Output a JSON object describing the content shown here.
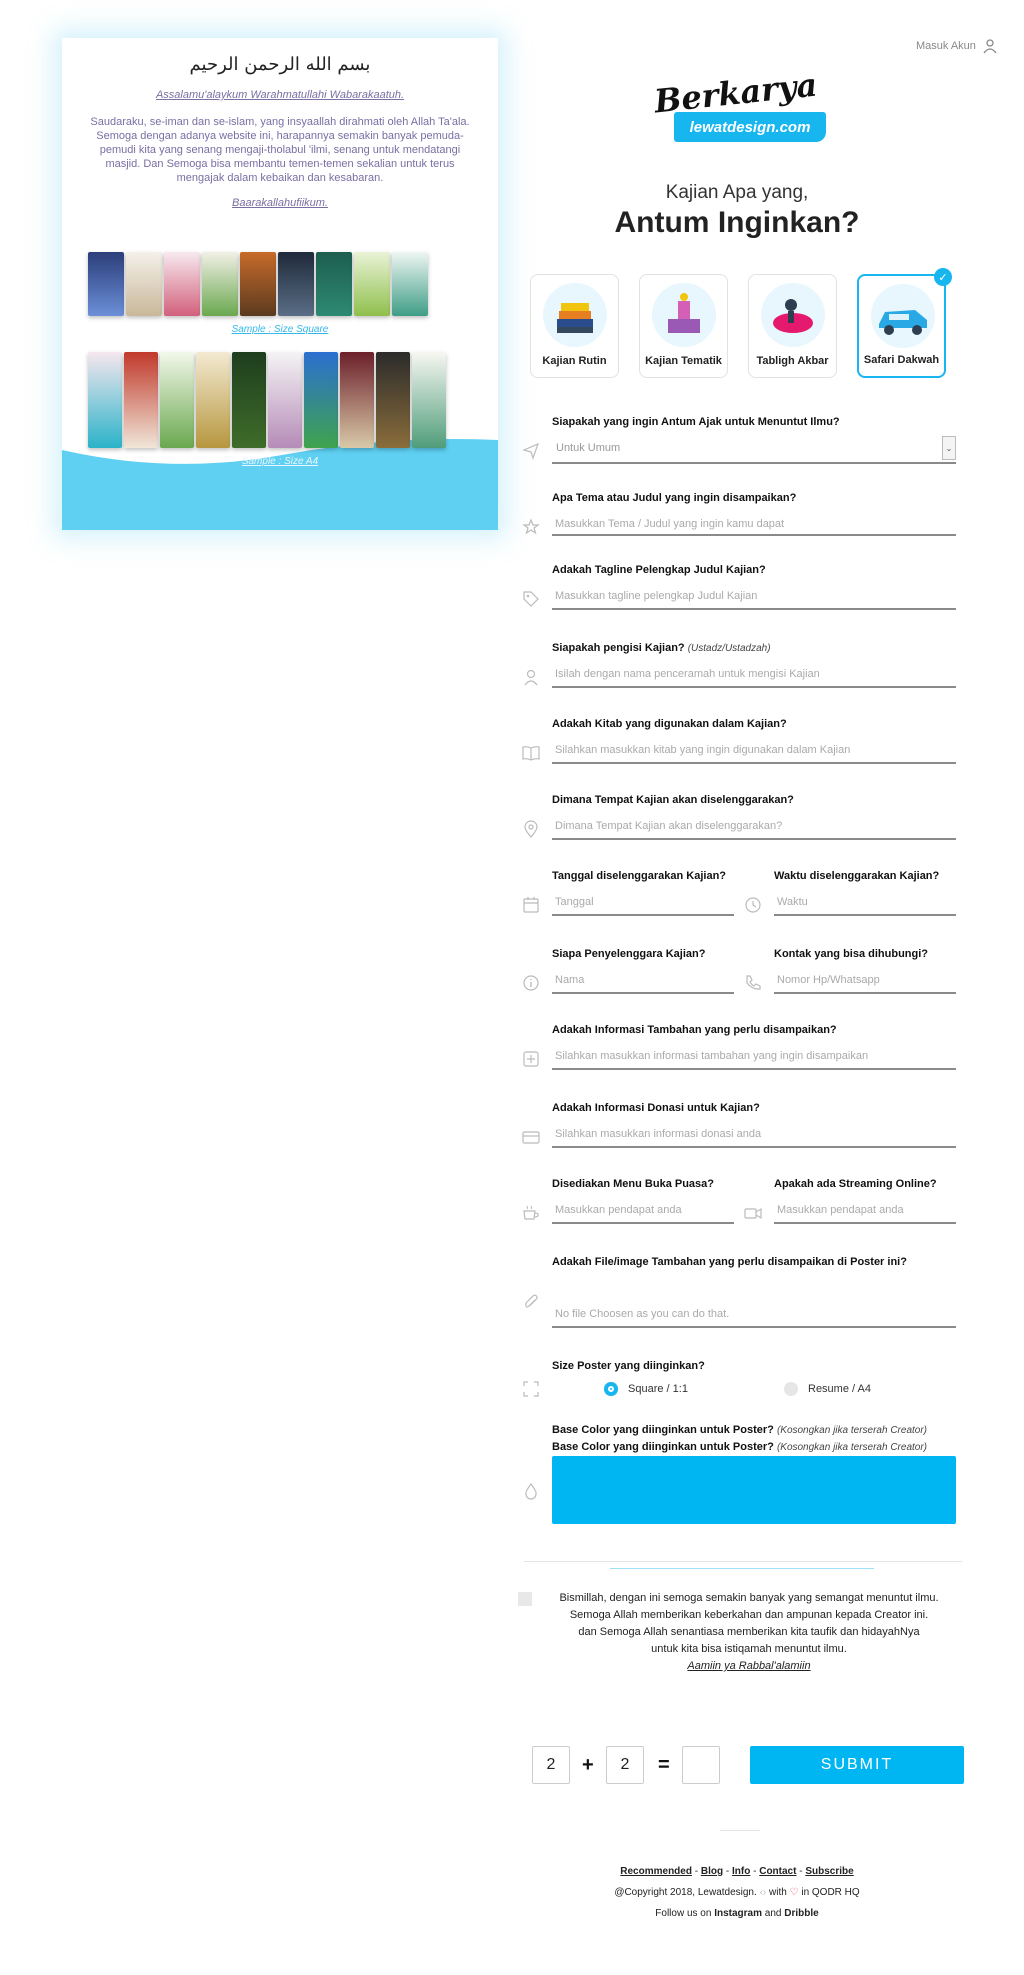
{
  "left_panel": {
    "bismillah": "بسم الله الرحمن الرحيم",
    "greeting": "Assalamu'alaykum Warahmatullahi Wabarakaatuh.",
    "intro": "Saudaraku, se-iman dan se-islam, yang insyaallah dirahmati oleh Allah Ta'ala. Semoga dengan adanya website ini, harapannya semakin banyak pemuda-pemudi kita yang senang mengaji-tholabul 'ilmi, senang untuk mendatangi masjid. Dan Semoga bisa membantu temen-temen sekalian untuk terus mengajak dalam kebaikan dan kesabaran.",
    "closing": "Baarakallahufiikum.",
    "sample_square": "Sample : Size Square",
    "sample_a4": "Sample : Size A4"
  },
  "header": {
    "login_label": "Masuk Akun",
    "logo_script": "Berkarya",
    "logo_tag": "lewatdesign.com",
    "subtitle": "Kajian Apa yang,",
    "title": "Antum Inginkan?"
  },
  "categories": [
    {
      "label": "Kajian Rutin",
      "icon": "books-icon",
      "active": false
    },
    {
      "label": "Kajian Tematik",
      "icon": "podium-icon",
      "active": false
    },
    {
      "label": "Tabligh Akbar",
      "icon": "speaker-icon",
      "active": false
    },
    {
      "label": "Safari Dakwah",
      "icon": "car-icon",
      "active": true
    }
  ],
  "form": {
    "q_invite": "Siapakah yang ingin Antum Ajak untuk Menuntut Ilmu?",
    "invite_value": "Untuk Umum",
    "q_title": "Apa Tema atau Judul yang ingin disampaikan?",
    "title_placeholder": "Masukkan Tema / Judul yang ingin kamu dapat",
    "q_tagline": "Adakah Tagline Pelengkap Judul Kajian?",
    "tagline_placeholder": "Masukkan tagline pelengkap Judul Kajian",
    "q_speaker": "Siapakah pengisi Kajian?",
    "q_speaker_note": "(Ustadz/Ustadzah)",
    "speaker_placeholder": "Isilah dengan nama penceramah untuk mengisi Kajian",
    "q_book": "Adakah Kitab yang digunakan dalam Kajian?",
    "book_placeholder": "Silahkan masukkan kitab yang ingin digunakan dalam Kajian",
    "q_place": "Dimana Tempat Kajian akan diselenggarakan?",
    "place_placeholder": "Dimana Tempat Kajian akan diselenggarakan?",
    "q_date": "Tanggal diselenggarakan Kajian?",
    "date_placeholder": "Tanggal",
    "q_time": "Waktu diselenggarakan Kajian?",
    "time_placeholder": "Waktu",
    "q_organizer": "Siapa Penyelenggara Kajian?",
    "organizer_placeholder": "Nama",
    "q_contact": "Kontak yang bisa dihubungi?",
    "contact_placeholder": "Nomor Hp/Whatsapp",
    "q_info": "Adakah Informasi Tambahan yang perlu disampaikan?",
    "info_placeholder": "Silahkan masukkan informasi tambahan yang ingin disampaikan",
    "q_donation": "Adakah Informasi Donasi untuk Kajian?",
    "donation_placeholder": "Silahkan masukkan informasi donasi anda",
    "q_iftar": "Disediakan Menu Buka Puasa?",
    "iftar_placeholder": "Masukkan pendapat anda",
    "q_stream": "Apakah ada Streaming Online?",
    "stream_placeholder": "Masukkan pendapat anda",
    "q_file": "Adakah File/image Tambahan yang perlu disampaikan di Poster ini?",
    "file_placeholder": "No file Choosen as you can do that.",
    "q_size": "Size Poster yang diinginkan?",
    "size_square": "Square / 1:1",
    "size_a4": "Resume / A4",
    "q_color": "Base Color yang diinginkan untuk Poster?",
    "q_color_note": "(Kosongkan jika terserah Creator)",
    "base_color": "#00b6f2"
  },
  "agreement": {
    "line1": "Bismillah, dengan ini semoga semakin banyak yang semangat menuntut ilmu.",
    "line2": "Semoga Allah memberikan keberkahan dan ampunan kepada Creator ini.",
    "line3": "dan Semoga Allah senantiasa memberikan kita taufik dan hidayahNya",
    "line4": "untuk kita bisa istiqamah menuntut ilmu.",
    "line5": "Aamiin ya Rabbal'alamiin"
  },
  "captcha": {
    "a": "2",
    "op": "+",
    "b": "2",
    "eq": "=",
    "answer": ""
  },
  "submit_label": "SUBMIT",
  "footer": {
    "links": [
      "Recommended",
      "Blog",
      "Info",
      "Contact",
      "Subscribe"
    ],
    "sep": "-",
    "copyright": "@Copyright 2018, Lewatdesign.",
    "with": "with",
    "in": "in QODR HQ",
    "follow_prefix": "Follow us on",
    "instagram": "Instagram",
    "and": "and",
    "dribbble": "Dribble"
  },
  "colors": {
    "accent": "#17b6ef",
    "text_muted": "#7a6ea3"
  }
}
